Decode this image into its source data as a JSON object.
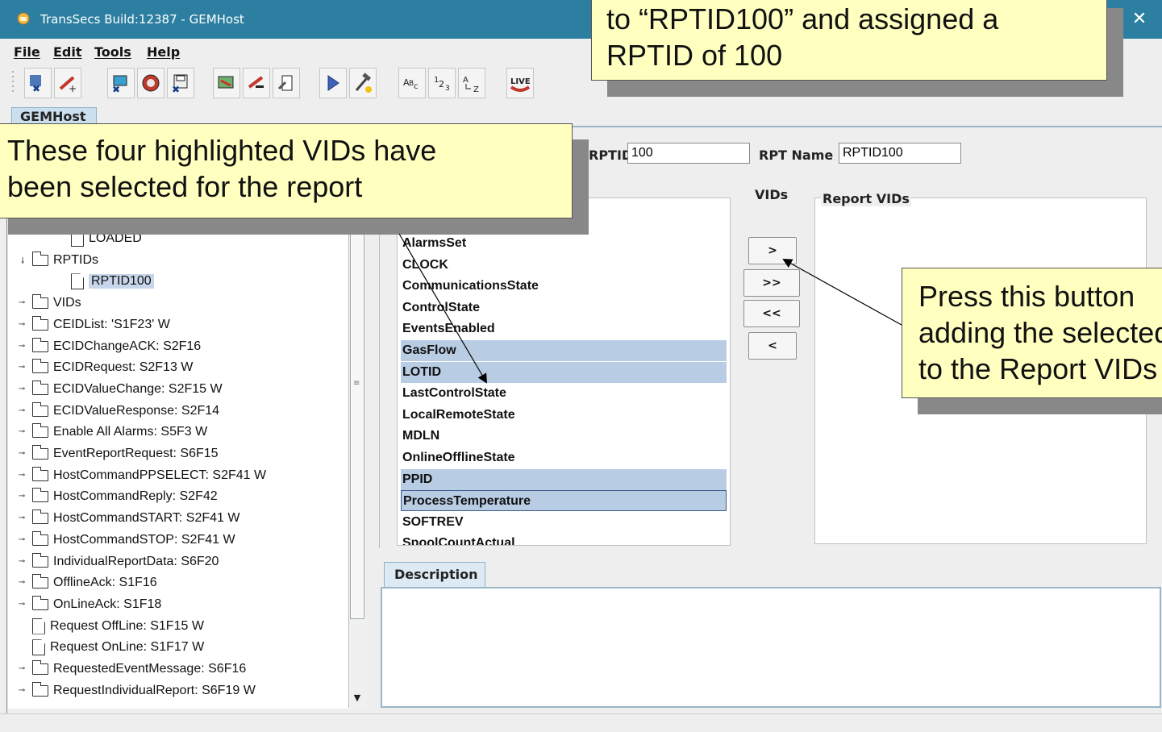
{
  "window": {
    "title": "TransSecs Build:12387 - GEMHost",
    "close_glyph": "✕"
  },
  "menu": [
    "File",
    "Edit",
    "Tools",
    "Help"
  ],
  "tab": {
    "label": "GEMHost"
  },
  "tree": {
    "items": [
      {
        "label": "LOADED",
        "kind": "doc",
        "depth": 2
      },
      {
        "label": "RPTIDs",
        "kind": "folder-open",
        "depth": 1
      },
      {
        "label": "RPTID100",
        "kind": "doc",
        "depth": 2,
        "selected": true
      },
      {
        "label": "VIDs",
        "kind": "folder",
        "depth": 1
      },
      {
        "label": "CEIDList: 'S1F23' W",
        "kind": "folder",
        "depth": 1
      },
      {
        "label": "ECIDChangeACK: S2F16",
        "kind": "folder",
        "depth": 1
      },
      {
        "label": "ECIDRequest: S2F13 W",
        "kind": "folder",
        "depth": 1
      },
      {
        "label": "ECIDValueChange: S2F15 W",
        "kind": "folder",
        "depth": 1
      },
      {
        "label": "ECIDValueResponse: S2F14",
        "kind": "folder",
        "depth": 1
      },
      {
        "label": "Enable All Alarms: S5F3 W",
        "kind": "folder",
        "depth": 1
      },
      {
        "label": "EventReportRequest: S6F15",
        "kind": "folder",
        "depth": 1
      },
      {
        "label": "HostCommandPPSELECT: S2F41 W",
        "kind": "folder",
        "depth": 1
      },
      {
        "label": "HostCommandReply: S2F42",
        "kind": "folder",
        "depth": 1
      },
      {
        "label": "HostCommandSTART: S2F41 W",
        "kind": "folder",
        "depth": 1
      },
      {
        "label": "HostCommandSTOP: S2F41 W",
        "kind": "folder",
        "depth": 1
      },
      {
        "label": "IndividualReportData: S6F20",
        "kind": "folder",
        "depth": 1
      },
      {
        "label": "OfflineAck: S1F16",
        "kind": "folder",
        "depth": 1
      },
      {
        "label": "OnLineAck: S1F18",
        "kind": "folder",
        "depth": 1
      },
      {
        "label": "Request OffLine: S1F15 W",
        "kind": "doc",
        "depth": 1
      },
      {
        "label": "Request OnLine: S1F17 W",
        "kind": "doc",
        "depth": 1
      },
      {
        "label": "RequestedEventMessage: S6F16",
        "kind": "folder",
        "depth": 1
      },
      {
        "label": "RequestIndividualReport: S6F19 W",
        "kind": "folder",
        "depth": 1
      }
    ]
  },
  "form": {
    "rptid_label": "RPTID",
    "rptid_value": "100",
    "rpt_name_label": "RPT Name",
    "rpt_name_value": "RPTID100",
    "vids_label": "VIDs",
    "report_vids_label": "Report VIDs"
  },
  "vid_list": [
    {
      "label": "AlarmsSet",
      "selected": false
    },
    {
      "label": "CLOCK",
      "selected": false
    },
    {
      "label": "CommunicationsState",
      "selected": false
    },
    {
      "label": "ControlState",
      "selected": false
    },
    {
      "label": "EventsEnabled",
      "selected": false
    },
    {
      "label": "GasFlow",
      "selected": true
    },
    {
      "label": "LOTID",
      "selected": true
    },
    {
      "label": "LastControlState",
      "selected": false
    },
    {
      "label": "LocalRemoteState",
      "selected": false
    },
    {
      "label": "MDLN",
      "selected": false
    },
    {
      "label": "OnlineOfflineState",
      "selected": false
    },
    {
      "label": "PPID",
      "selected": true
    },
    {
      "label": "ProcessTemperature",
      "selected": true
    },
    {
      "label": "SOFTREV",
      "selected": false
    },
    {
      "label": "SpoolCountActual",
      "selected": false
    }
  ],
  "move_buttons": {
    "add": ">",
    "add_all": ">>",
    "remove_all": "<<",
    "remove": "<"
  },
  "description_tab": "Description",
  "callouts": {
    "top": [
      "to “RPTID100” and assigned a",
      "RPTID of 100"
    ],
    "left": [
      "These four highlighted VIDs have",
      "been selected for the report"
    ],
    "right": [
      "Press this button",
      "adding the selected",
      "to the Report VIDs"
    ]
  },
  "colors": {
    "titlebar": "#2c7fa0",
    "selection": "#b8cce4",
    "callout": "#ffffc0"
  }
}
